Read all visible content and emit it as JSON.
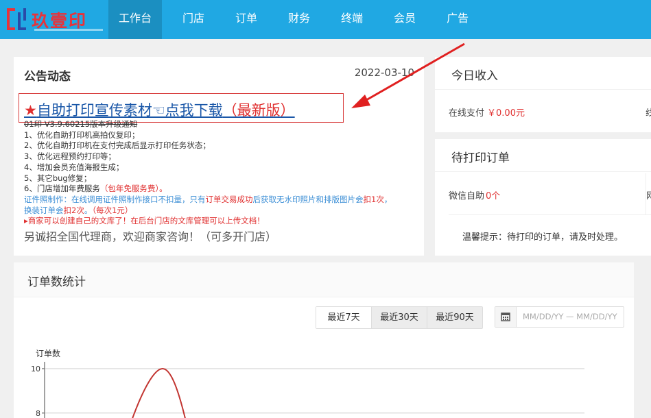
{
  "brand": {
    "name": "玖壹印"
  },
  "nav": [
    {
      "label": "工作台",
      "active": true
    },
    {
      "label": "门店",
      "active": false
    },
    {
      "label": "订单",
      "active": false
    },
    {
      "label": "财务",
      "active": false
    },
    {
      "label": "终端",
      "active": false
    },
    {
      "label": "会员",
      "active": false
    },
    {
      "label": "广告",
      "active": false
    }
  ],
  "announcement": {
    "title": "公告动态",
    "date": "2022-03-10",
    "link_star": "★",
    "link_main": "自助打印宣传素材☜点我下载",
    "link_tail": "（最新版）",
    "version_line": "01印 V3.9.60215版本升级通知",
    "items": [
      "1、优化自助打印机高拍仪复印；",
      "2、优化自助打印机在支付完成后显示打印任务状态；",
      "3、优化远程预约打印等；",
      "4、增加会员充值海报生成；",
      "5、其它bug修复；"
    ],
    "item6_prefix": "6、门店增加年费服务",
    "item6_red": "（包年免服务费）。",
    "id_photo_line1_a": "证件照制作：在线调用证件照制作接口不扣量，只有",
    "id_photo_line1_b": "订单交易成功",
    "id_photo_line1_c": "后获取无水印照片和排版图片会",
    "id_photo_line1_d": "扣1次",
    "id_photo_line1_e": "，",
    "id_photo_line2_a": "换装订单会",
    "id_photo_line2_b": "扣2次",
    "id_photo_line2_c": "。",
    "id_photo_line2_d": "（每次1元）",
    "library_line": "▸商家可以创建自己的文库了！在后台门店的文库管理可以上传文档！",
    "agent_line": "另诚招全国代理商，欢迎商家咨询！（可多开门店）"
  },
  "income": {
    "title": "今日收入",
    "label": "在线支付",
    "amount": "￥0.00元",
    "clipped": "线"
  },
  "pending": {
    "title": "待打印订单",
    "label": "微信自助",
    "count": "0个",
    "clipped": "网",
    "tip": "温馨提示：待打印的订单，请及时处理。"
  },
  "stats": {
    "title": "订单数统计",
    "ranges": [
      "最近7天",
      "最近30天",
      "最近90天"
    ],
    "date_placeholder": "MM/DD/YY — MM/DD/YY",
    "chart_data": {
      "type": "line",
      "ylabel": "订单数",
      "yticks": [
        8,
        10
      ],
      "ylim": [
        7.5,
        10
      ],
      "series": [
        {
          "values": [
            7.5,
            10,
            7.5
          ]
        }
      ]
    }
  },
  "colors": {
    "nav": "#20a8e3",
    "accent_red": "#e03030",
    "link_blue": "#1a57a8"
  }
}
